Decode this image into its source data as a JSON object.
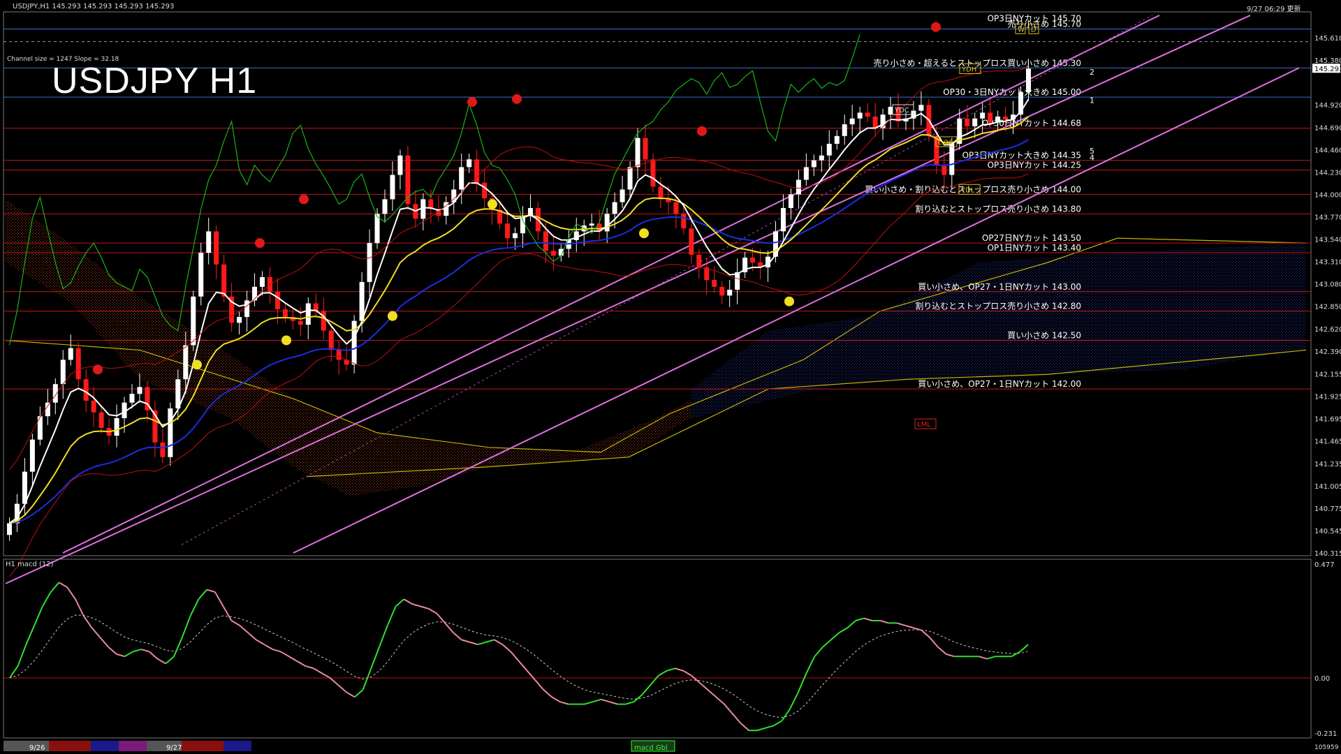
{
  "header": {
    "symbol_info": "USDJPY,H1  145.293 145.293 145.293 145.293",
    "channel_info": "Channel size = 1247 Slope = 32.18",
    "title": "USDJPY H1",
    "update_time": "9/27 06:29 更新"
  },
  "levels": [
    {
      "price": 145.7,
      "label": "売り小さめ 145.70",
      "top_label": "OP3日NYカット 145.70",
      "color": "#3a6fd0",
      "dashed": false
    },
    {
      "price": 145.57,
      "label": "",
      "color": "#9a9a9a",
      "dashed": true
    },
    {
      "price": 145.3,
      "label": "売り小さめ・超えるとストップロス買い小さめ 145.30",
      "color": "#3a6fd0",
      "dashed": false
    },
    {
      "price": 145.0,
      "label": "OP30・3日NYカット大きめ 145.00",
      "color": "#3a6fd0",
      "dashed": false
    },
    {
      "price": 144.68,
      "label": "OP30日NYカット 144.68",
      "color": "#c01818",
      "dashed": false
    },
    {
      "price": 144.35,
      "label": "OP3日NYカット大きめ 144.35",
      "color": "#c01818",
      "dashed": false
    },
    {
      "price": 144.25,
      "label": "OP3日NYカット 144.25",
      "color": "#c01818",
      "dashed": false
    },
    {
      "price": 144.0,
      "label": "買い小さめ・割り込むとストップロス売り小さめ 144.00",
      "color": "#c01818",
      "dashed": false
    },
    {
      "price": 143.8,
      "label": "割り込むとストップロス売り小さめ 143.80",
      "color": "#c01818",
      "dashed": false
    },
    {
      "price": 143.5,
      "label": "OP27日NYカット 143.50",
      "color": "#c01818",
      "dashed": false
    },
    {
      "price": 143.4,
      "label": "OP1日NYカット 143.40",
      "color": "#c01818",
      "dashed": false
    },
    {
      "price": 143.0,
      "label": "買い小さめ、OP27・1日NYカット 143.00",
      "color": "#c01818",
      "dashed": false
    },
    {
      "price": 142.8,
      "label": "割り込むとストップロス売り小さめ 142.80",
      "color": "#c01818",
      "dashed": false
    },
    {
      "price": 142.5,
      "label": "買い小さめ 142.50",
      "color": "#c01818",
      "dashed": false
    },
    {
      "price": 142.0,
      "label": "買い小さめ、OP27・1日NYカット 142.00",
      "color": "#c01818",
      "dashed": false
    }
  ],
  "current_price": "145.293",
  "markers": [
    "YDH",
    "YDC",
    "LVH",
    "YDL",
    "LML",
    "W",
    "D"
  ],
  "channel_labels": [
    "2",
    "1",
    "5",
    "4"
  ],
  "macd_panel": {
    "label": "H1  macd (12)",
    "scale": [
      "0.477",
      "0.00",
      "-0.231"
    ],
    "status": "macd Gbl"
  },
  "bottom_bar": {
    "dates": [
      "9/26",
      "9/27"
    ],
    "right_value": "105959"
  },
  "chart_data": [
    {
      "type": "candlestick",
      "title": "USDJPY H1",
      "y_ticks": [
        "145.610",
        "145.380",
        "145.293",
        "144.920",
        "144.690",
        "144.460",
        "144.230",
        "144.000",
        "143.770",
        "143.540",
        "143.310",
        "143.080",
        "142.850",
        "142.620",
        "142.390",
        "142.155",
        "141.925",
        "141.695",
        "141.465",
        "141.235",
        "141.005",
        "140.775",
        "140.545",
        "140.315"
      ],
      "ylim": [
        140.315,
        145.84
      ],
      "x_ticks": [
        "9/26",
        "9/27"
      ],
      "closes": [
        140.62,
        140.82,
        141.15,
        141.48,
        141.72,
        141.86,
        142.05,
        142.3,
        142.42,
        142.1,
        141.88,
        141.76,
        141.6,
        141.52,
        141.7,
        141.86,
        141.95,
        142.02,
        141.78,
        141.45,
        141.3,
        141.8,
        142.1,
        142.45,
        142.95,
        143.4,
        143.62,
        143.28,
        142.95,
        142.68,
        142.74,
        142.91,
        143.05,
        143.15,
        143.0,
        142.82,
        142.74,
        142.7,
        142.66,
        142.88,
        142.8,
        142.6,
        142.4,
        142.3,
        142.25,
        142.7,
        143.1,
        143.5,
        143.8,
        143.95,
        144.2,
        144.4,
        143.9,
        143.75,
        143.95,
        143.85,
        143.78,
        143.92,
        144.05,
        144.28,
        144.36,
        144.12,
        143.96,
        143.84,
        143.7,
        143.55,
        143.6,
        143.78,
        143.86,
        143.62,
        143.42,
        143.37,
        143.44,
        143.53,
        143.62,
        143.68,
        143.7,
        143.62,
        143.8,
        143.92,
        144.05,
        144.28,
        144.58,
        144.36,
        144.08,
        143.95,
        143.92,
        143.8,
        143.65,
        143.38,
        143.25,
        143.12,
        143.05,
        142.96,
        143.02,
        143.2,
        143.35,
        143.3,
        143.25,
        143.36,
        143.62,
        143.86,
        144.0,
        144.15,
        144.28,
        144.35,
        144.4,
        144.52,
        144.6,
        144.72,
        144.78,
        144.84,
        144.8,
        144.68,
        144.82,
        144.9,
        144.75,
        144.78,
        144.86,
        144.92,
        144.6,
        144.3,
        144.2,
        144.52,
        144.78,
        144.7,
        144.78,
        144.84,
        144.74,
        144.8,
        144.77,
        144.82,
        145.05,
        145.293
      ],
      "macd": [
        0.0,
        0.05,
        0.14,
        0.22,
        0.3,
        0.36,
        0.4,
        0.38,
        0.33,
        0.26,
        0.21,
        0.17,
        0.13,
        0.1,
        0.09,
        0.11,
        0.12,
        0.11,
        0.08,
        0.06,
        0.09,
        0.17,
        0.26,
        0.33,
        0.37,
        0.36,
        0.3,
        0.24,
        0.22,
        0.19,
        0.16,
        0.14,
        0.12,
        0.11,
        0.09,
        0.07,
        0.05,
        0.04,
        0.02,
        0.0,
        -0.03,
        -0.06,
        -0.08,
        -0.05,
        0.04,
        0.13,
        0.22,
        0.3,
        0.33,
        0.31,
        0.3,
        0.29,
        0.27,
        0.23,
        0.19,
        0.16,
        0.15,
        0.14,
        0.15,
        0.16,
        0.14,
        0.11,
        0.07,
        0.03,
        -0.01,
        -0.05,
        -0.08,
        -0.1,
        -0.11,
        -0.11,
        -0.11,
        -0.1,
        -0.09,
        -0.1,
        -0.11,
        -0.11,
        -0.1,
        -0.07,
        -0.03,
        0.01,
        0.03,
        0.04,
        0.03,
        0.01,
        -0.02,
        -0.05,
        -0.08,
        -0.11,
        -0.15,
        -0.19,
        -0.22,
        -0.22,
        -0.21,
        -0.2,
        -0.18,
        -0.13,
        -0.06,
        0.02,
        0.09,
        0.13,
        0.16,
        0.19,
        0.21,
        0.24,
        0.25,
        0.24,
        0.24,
        0.23,
        0.23,
        0.22,
        0.21,
        0.2,
        0.17,
        0.13,
        0.1,
        0.09,
        0.09,
        0.09,
        0.09,
        0.08,
        0.09,
        0.09,
        0.09,
        0.11,
        0.14
      ],
      "macd_ylim": [
        -0.231,
        0.477
      ]
    }
  ]
}
